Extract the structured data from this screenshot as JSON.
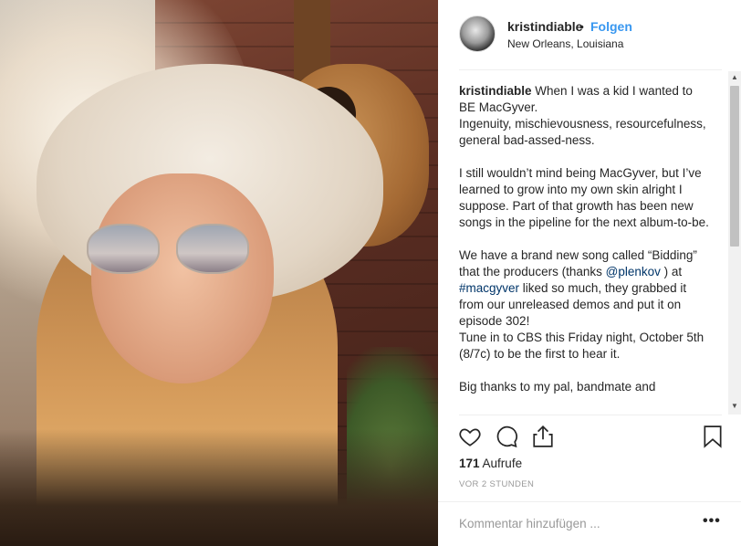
{
  "post": {
    "username": "kristindiable",
    "separator": "•",
    "follow_label": "Folgen",
    "location": "New Orleans, Louisiana"
  },
  "caption": {
    "author": "kristindiable",
    "line1": "When I was a kid I wanted to BE MacGyver.",
    "line2": "Ingenuity, mischievousness, resourcefulness, general bad-assed-ness.",
    "line3": "I still wouldn’t mind being MacGyver, but I’ve learned to grow into my own skin alright I suppose. Part of that growth has been new songs in the pipeline for the next album-to-be.",
    "line4a": "We have a brand new song called “Bidding” that the producers (thanks",
    "mention": "@plenkov",
    "line4b": ") at",
    "hashtag": "#macgyver",
    "line4c": "liked so much, they grabbed it from our unreleased demos and put it on episode 302!",
    "line5": "Tune in to CBS this Friday night, October 5th (8/7c) to be the first to hear it.",
    "line6": "Big thanks to my pal, bandmate and"
  },
  "scroll": {
    "up_arrow": "▲",
    "down_arrow": "▼"
  },
  "icons": {
    "like": "heart-icon",
    "comment": "comment-icon",
    "share": "share-icon",
    "save": "bookmark-icon"
  },
  "stats": {
    "views_count": "171",
    "views_label": "Aufrufe",
    "timestamp": "VOR 2 STUNDEN"
  },
  "comment_box": {
    "placeholder": "Kommentar hinzufügen ...",
    "more_label": "•••"
  },
  "colors": {
    "link": "#3897f0",
    "text": "#262626",
    "muted": "#999999"
  }
}
